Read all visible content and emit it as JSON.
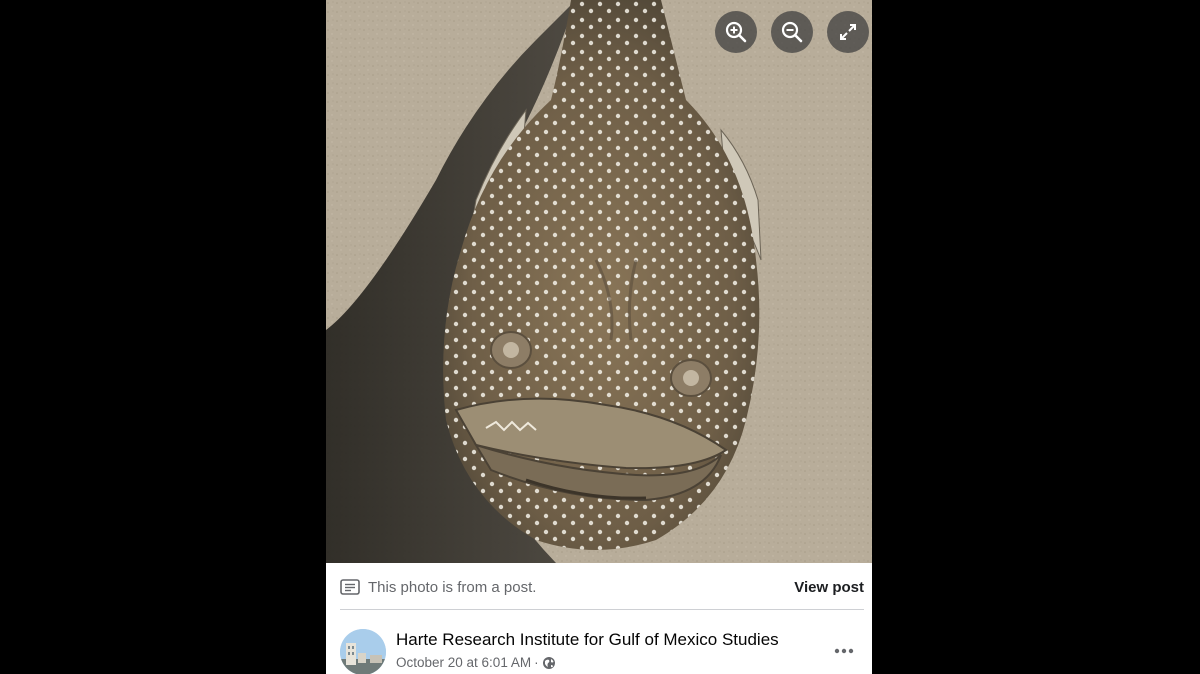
{
  "viewer": {
    "photo": {
      "subject": "spotted fish on sand",
      "colors": {
        "sand": "#b5aa97",
        "shadow": "#3a3733",
        "fish": "#7b6a52",
        "spots": "#f4f1e8"
      }
    },
    "controls": [
      {
        "name": "zoom-in",
        "icon": "zoom-in-icon"
      },
      {
        "name": "zoom-out",
        "icon": "zoom-out-icon"
      },
      {
        "name": "fullscreen",
        "icon": "expand-icon"
      }
    ]
  },
  "post": {
    "notice": "This photo is from a post.",
    "view_post_label": "View post",
    "author": "Harte Research Institute for Gulf of Mexico Studies",
    "date": "October 20 at 6:01 AM",
    "separator": "·",
    "privacy_icon": "globe-icon",
    "more_icon": "more-options-icon"
  }
}
